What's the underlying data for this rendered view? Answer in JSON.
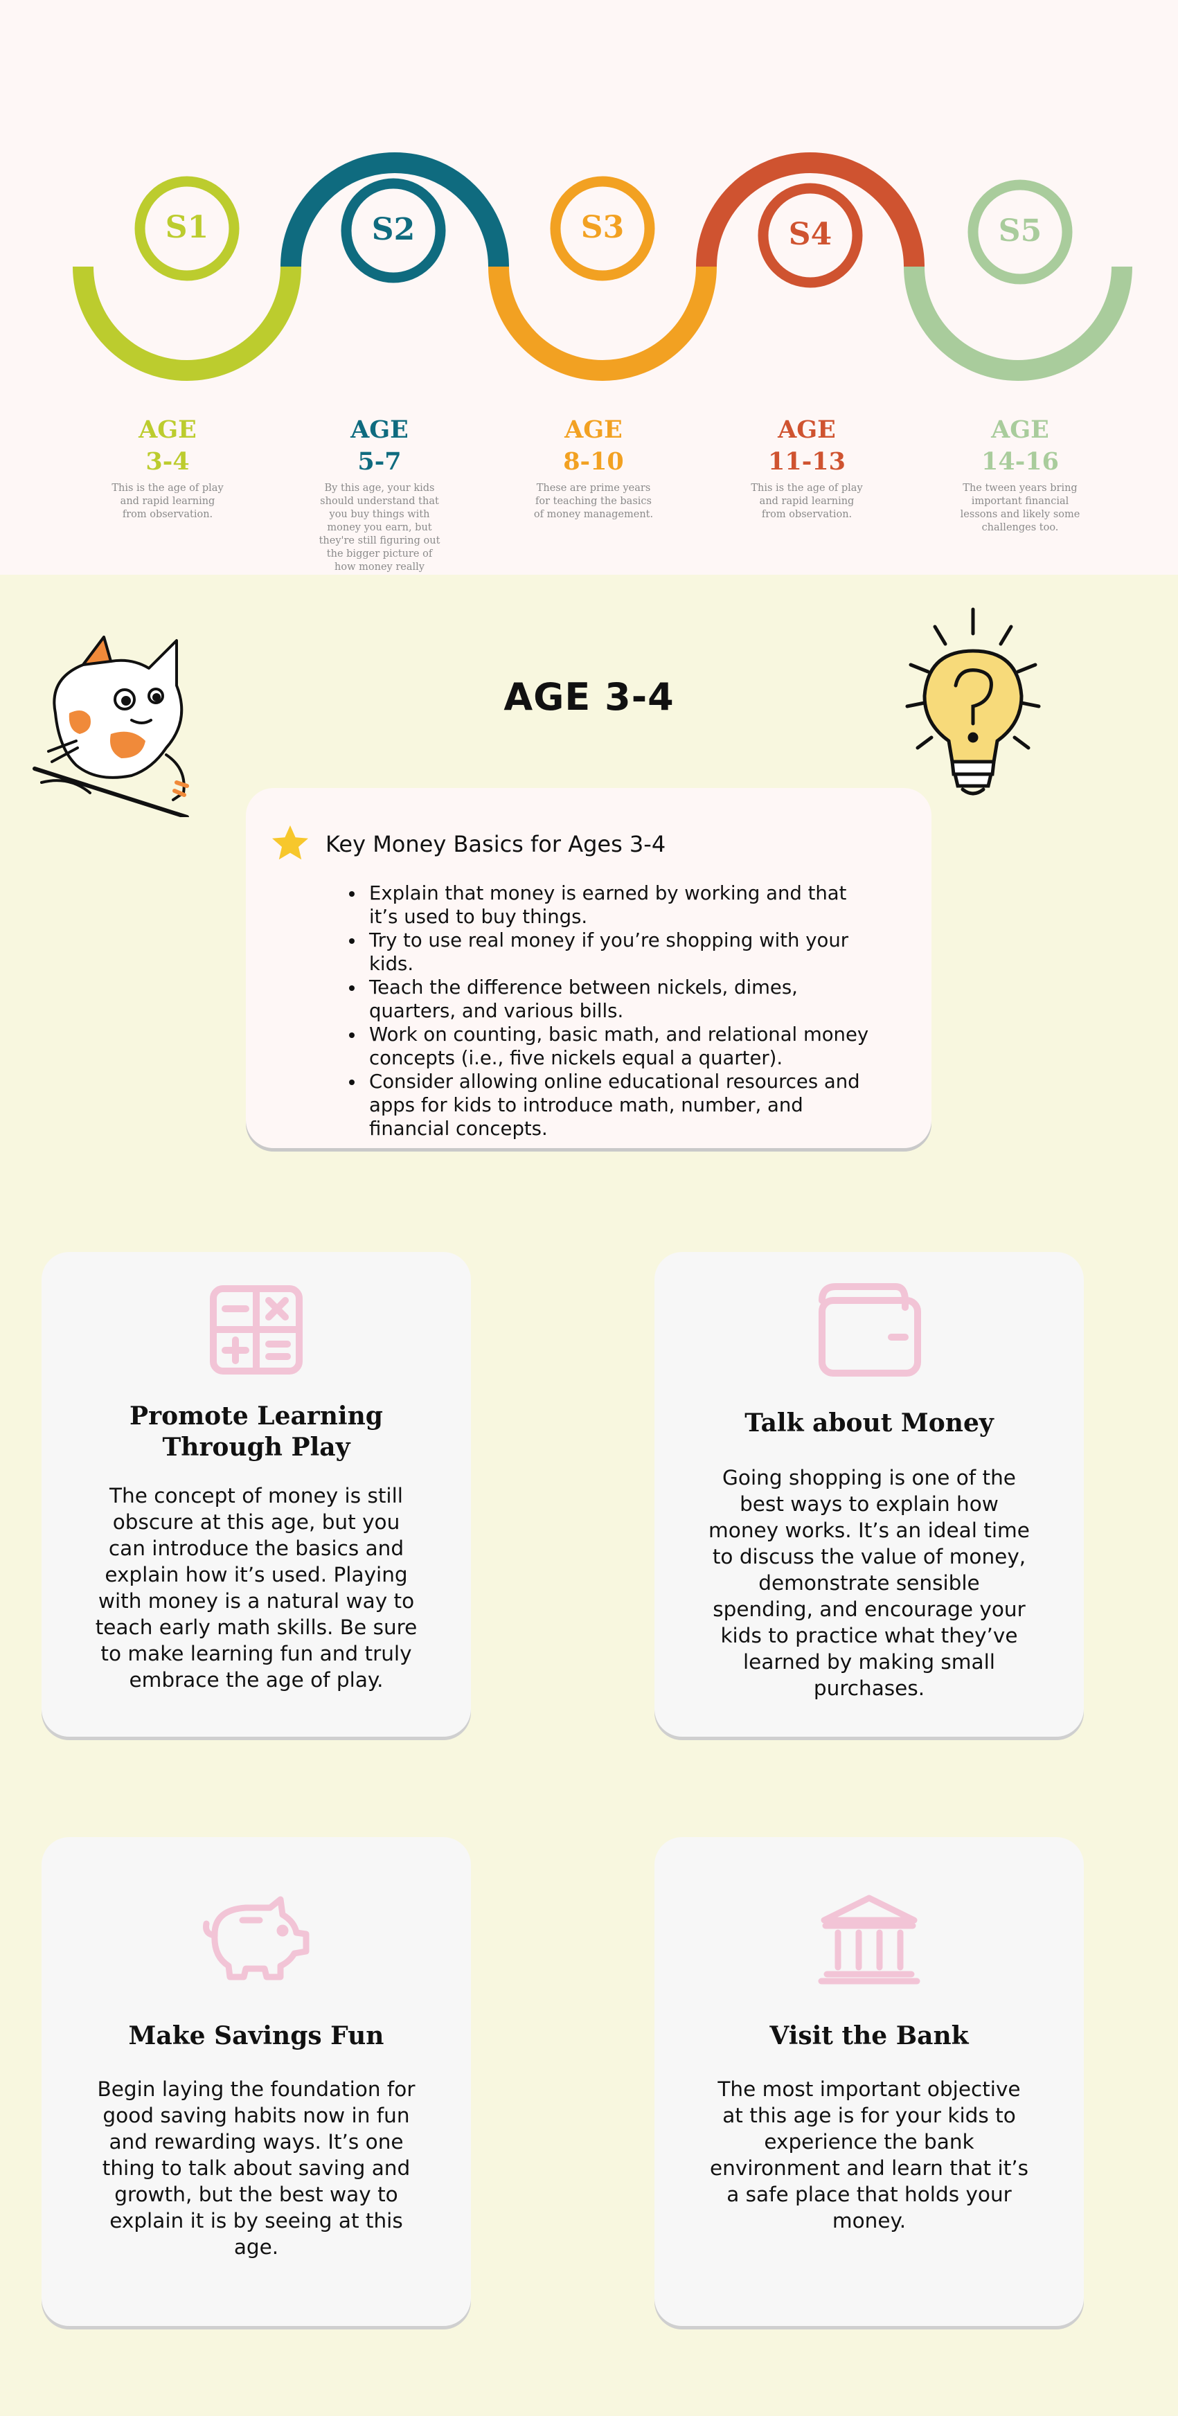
{
  "timeline": {
    "stages": [
      {
        "badge": "S1",
        "age_word": "AGE",
        "range": "3-4",
        "desc": "This is the age of play and rapid learning from observation.",
        "color": "#bccc2e"
      },
      {
        "badge": "S2",
        "age_word": "AGE",
        "range": "5-7",
        "desc": "By this age, your kids should understand that you buy things with money you earn, but they're still figuring out the bigger picture of how money really works.",
        "color": "#0f6b7f"
      },
      {
        "badge": "S3",
        "age_word": "AGE",
        "range": "8-10",
        "desc": "These are prime years for teaching the basics of money management.",
        "color": "#f2a122"
      },
      {
        "badge": "S4",
        "age_word": "AGE",
        "range": "11-13",
        "desc": "This is the age of play and rapid learning from observation.",
        "color": "#cf5330"
      },
      {
        "badge": "S5",
        "age_word": "AGE",
        "range": "14-16",
        "desc": "The tween years bring important financial lessons and likely some challenges too.",
        "color": "#a9cc9c"
      }
    ]
  },
  "section": {
    "title": "AGE 3-4"
  },
  "basics": {
    "title": "Key Money Basics for Ages 3-4",
    "items": [
      "Explain that money is earned by working and that it’s used to buy things.",
      "Try to use real money if you’re shopping with your kids.",
      "Teach the difference between nickels, dimes, quarters, and various bills.",
      "Work on counting, basic math, and relational money concepts (i.e., five nickels equal a quarter).",
      "Consider allowing online educational resources and apps for kids to introduce math, number, and financial concepts."
    ],
    "icon": "star-icon",
    "icon_color": "#f7c72c"
  },
  "cards": [
    {
      "icon": "calculator-icon",
      "title": "Promote Learning Through Play",
      "text": "The concept of money is still obscure at this age, but you can introduce the basics and explain how it’s used. Playing with money is a natural way to teach early math skills. Be sure to make learning fun and truly embrace the age of play."
    },
    {
      "icon": "wallet-icon",
      "title": "Talk about Money",
      "text": "Going shopping is one of the best ways to explain how money works. It’s an ideal time to discuss the value of money, demonstrate sensible spending, and encourage your kids to practice what they’ve learned by making small purchases."
    },
    {
      "icon": "piggy-bank-icon",
      "title": "Make Savings Fun",
      "text": "Begin laying the foundation for good saving habits now in fun and rewarding ways. It’s one thing to talk about saving and growth, but the best way to explain it is by seeing at this age."
    },
    {
      "icon": "bank-icon",
      "title": "Visit the Bank",
      "text": "The most important objective at this age is for your kids to experience the bank environment and learn that it’s a safe place that holds your money."
    }
  ],
  "colors": {
    "icon_pink": "#f2c4d6",
    "top_bg": "#fef7f6",
    "bottom_bg": "#f8f7df"
  }
}
